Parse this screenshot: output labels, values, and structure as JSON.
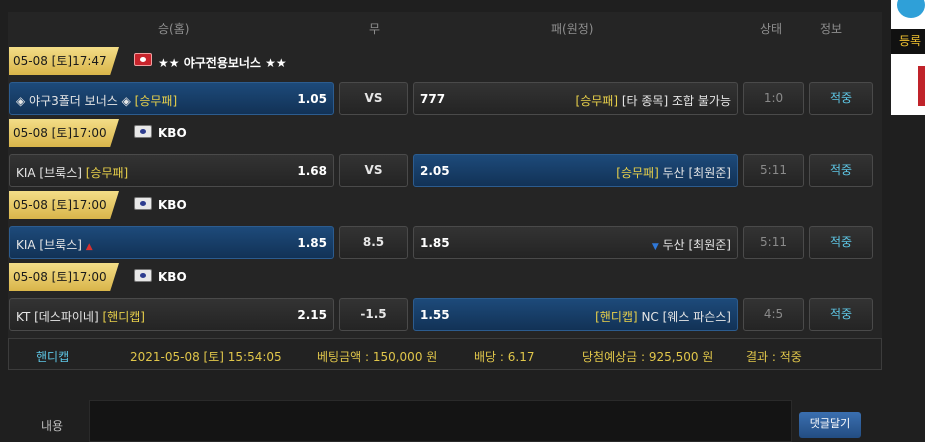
{
  "header": {
    "home": "승(홈)",
    "draw": "무",
    "away": "패(원정)",
    "status": "상태",
    "info": "정보"
  },
  "matches": [
    {
      "date": "05-08 [토]17:47",
      "league": "★★ 야구전용보너스 ★★",
      "flag_icon": "bonus-flag-icon",
      "home_team": "◈ 야구3폴더 보너스 ◈",
      "home_tag": "[승무패]",
      "home_odd": "1.05",
      "draw": "VS",
      "away_odd": "777",
      "away_tag": "[승무패]",
      "away_team": "[타 종목] 조합 불가능",
      "status": "1:0",
      "info": "적중"
    },
    {
      "date": "05-08 [토]17:00",
      "league": "KBO",
      "flag_icon": "korea-flag-icon",
      "home_team": "KIA [브룩스]",
      "home_tag": "[승무패]",
      "home_odd": "1.68",
      "draw": "VS",
      "away_odd": "2.05",
      "away_tag": "[승무패]",
      "away_team": "두산 [최원준]",
      "status": "5:11",
      "info": "적중"
    },
    {
      "date": "05-08 [토]17:00",
      "league": "KBO",
      "flag_icon": "korea-flag-icon",
      "home_team": "KIA [브룩스]",
      "home_tag": "",
      "home_odd": "1.85",
      "draw": "8.5",
      "away_odd": "1.85",
      "away_tag": "",
      "away_team": "두산 [최원준]",
      "status": "5:11",
      "info": "적중"
    },
    {
      "date": "05-08 [토]17:00",
      "league": "KBO",
      "flag_icon": "korea-flag-icon",
      "home_team": "KT [데스파이네]",
      "home_tag": "[핸디캡]",
      "home_odd": "2.15",
      "draw": "-1.5",
      "away_odd": "1.55",
      "away_tag": "[핸디캡]",
      "away_team": "NC [웨스 파슨스]",
      "status": "4:5",
      "info": "적중"
    }
  ],
  "summary": {
    "type": "핸디캡",
    "datetime": "2021-05-08 [토] 15:54:05",
    "bet_amount": "베팅금액 : 150,000 원",
    "odds": "배당 : 6.17",
    "expected_win": "당첨예상금 : 925,500 원",
    "result": "결과 : 적중"
  },
  "side": {
    "register": "등록"
  },
  "comment": {
    "label": "내용",
    "button": "댓글달기"
  },
  "colors": {
    "accent_yellow": "#e8d04a",
    "accent_cyan": "#5ec7e6",
    "selected_blue": "#1d4a7a",
    "date_gold": "#e4c45c"
  }
}
